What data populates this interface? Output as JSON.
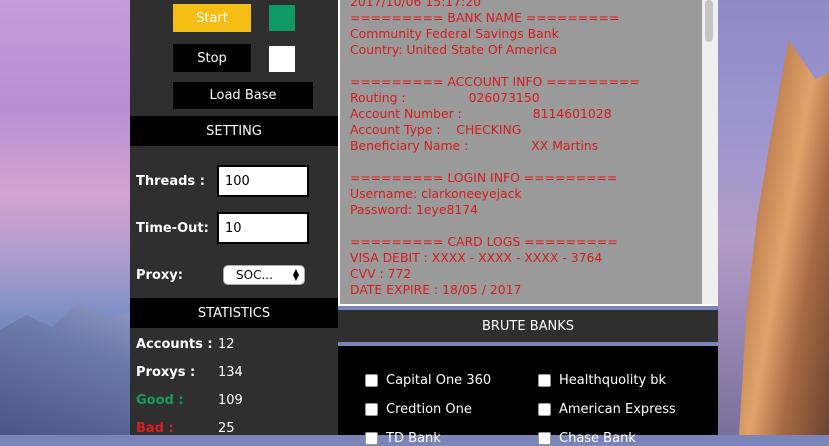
{
  "controls": {
    "start_label": "Start",
    "stop_label": "Stop",
    "load_base_label": "Load Base",
    "start_status_color": "#0e9966",
    "stop_status_color": "#ffffff",
    "start_button_color": "#f6bd14"
  },
  "setting": {
    "header": "SETTING",
    "threads_label": "Threads :",
    "threads_value": "100",
    "timeout_label": "Time-Out:",
    "timeout_value": "10",
    "proxy_label": "Proxy:",
    "proxy_value": "SOC..."
  },
  "statistics": {
    "header": "STATISTICS",
    "accounts_label": "Accounts :",
    "accounts_value": "12",
    "proxys_label": "Proxys :",
    "proxys_value": "134",
    "good_label": "Good :",
    "good_value": "109",
    "bad_label": "Bad :",
    "bad_value": "25"
  },
  "log": {
    "text": "2017/10/06 15:17:20\n========= BANK NAME =========\nCommunity Federal Savings Bank\nCountry: United State Of America\n\n========= ACCOUNT INFO =========\nRouting :                026073150\nAccount Number :                  8114601028\nAccount Type :    CHECKING\nBeneficiary Name :                XX Martins\n\n========= LOGIN INFO =========\nUsername: clarkoneeyejack\nPassword: 1eye8174\n\n========= CARD LOGS =========\nVISA DEBIT : XXXX - XXXX - XXXX - 3764\nCVV : 772\nDATE EXPIRE : 18/05 / 2017",
    "text_color": "#d31d1d"
  },
  "brute": {
    "header": "BRUTE BANKS",
    "banks": [
      {
        "label": "Capital One 360"
      },
      {
        "label": "Healthquolity bk"
      },
      {
        "label": "Credtion One"
      },
      {
        "label": "American Express"
      },
      {
        "label": "TD Bank"
      },
      {
        "label": "Chase Bank"
      }
    ]
  }
}
